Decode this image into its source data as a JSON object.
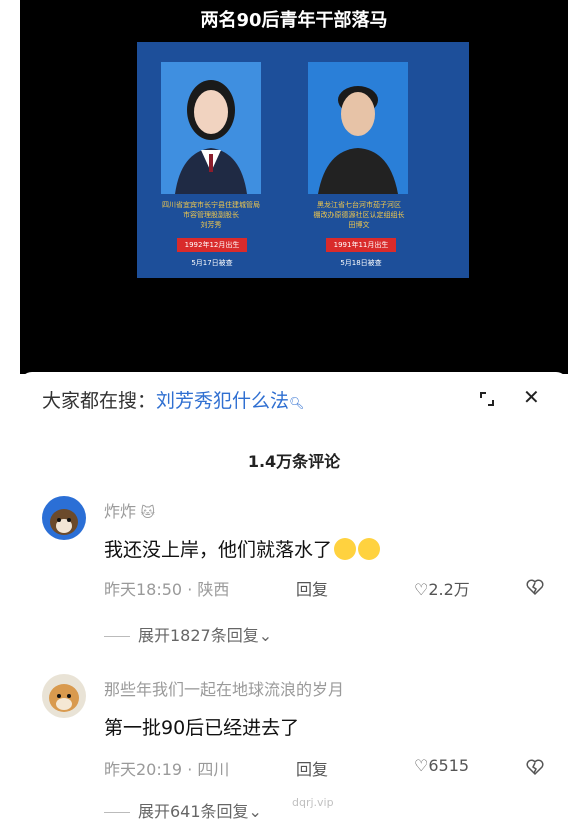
{
  "video": {
    "title": "两名90后青年干部落马",
    "left_person": {
      "caption_line1": "四川省宜宾市长宁县住建城管局",
      "caption_line2": "市容管理股副股长",
      "name": "刘芳秀",
      "born": "1992年12月出生",
      "date": "5月17日被查"
    },
    "right_person": {
      "caption_line1": "黑龙江省七台河市茄子河区",
      "caption_line2": "棚改办原德源社区认定组组长",
      "name": "田博文",
      "born": "1991年11月出生",
      "date": "5月18日被查"
    }
  },
  "search": {
    "prefix": "大家都在搜：",
    "keyword": "刘芳秀犯什么法"
  },
  "comments_count": "1.4万条评论",
  "comments": [
    {
      "user": "炸炸",
      "text": "我还没上岸，他们就落水了",
      "time": "昨天18:50",
      "location": "陕西",
      "reply": "回复",
      "likes": "2.2万",
      "expand": "展开1827条回复"
    },
    {
      "user": "那些年我们一起在地球流浪的岁月",
      "text": "第一批90后已经进去了",
      "time": "昨天20:19",
      "location": "四川",
      "reply": "回复",
      "likes": "6515",
      "expand": "展开641条回复"
    }
  ],
  "watermark": "dqrj.vip",
  "icons": [
    "search-icon",
    "expand-icon",
    "close-icon",
    "heart-icon",
    "dislike-icon",
    "chevron-down-icon"
  ]
}
